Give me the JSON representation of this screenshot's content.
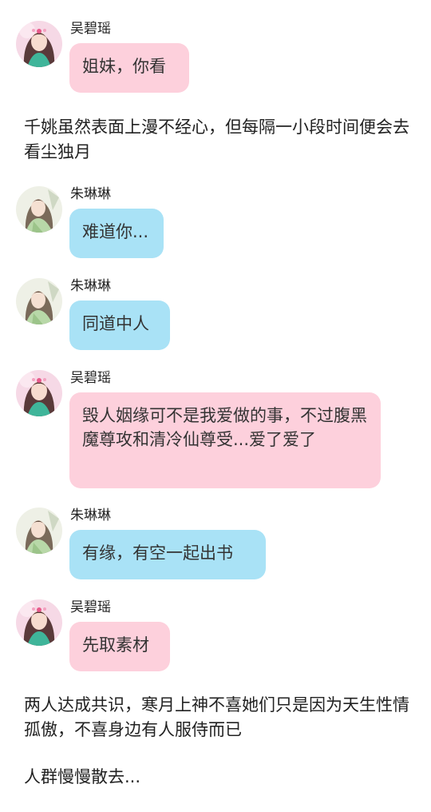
{
  "characters": {
    "wu": {
      "name": "吴碧瑶",
      "avatar_icon": "pink-haired-girl-avatar-icon",
      "bubble_color": "#fdd0dc"
    },
    "zhu": {
      "name": "朱琳琳",
      "avatar_icon": "green-robed-girl-avatar-icon",
      "bubble_color": "#a9e2f6"
    }
  },
  "messages": [
    {
      "sender": "吴碧瑶",
      "text": "姐妹，你看"
    },
    {
      "narration": "千姚虽然表面上漫不经心，但每隔一小段时间便会去看尘独月"
    },
    {
      "sender": "朱琳琳",
      "text": "难道你..."
    },
    {
      "sender": "朱琳琳",
      "text": "同道中人"
    },
    {
      "sender": "吴碧瑶",
      "text": "毁人姻缘可不是我爱做的事，不过腹黑魔尊攻和清冷仙尊受...爱了爱了"
    },
    {
      "sender": "朱琳琳",
      "text": "有缘，有空一起出书"
    },
    {
      "sender": "吴碧瑶",
      "text": "先取素材"
    },
    {
      "narration": "两人达成共识，寒月上神不喜她们只是因为天生性情孤傲，不喜身边有人服侍而已"
    },
    {
      "narration": "人群慢慢散去..."
    }
  ]
}
